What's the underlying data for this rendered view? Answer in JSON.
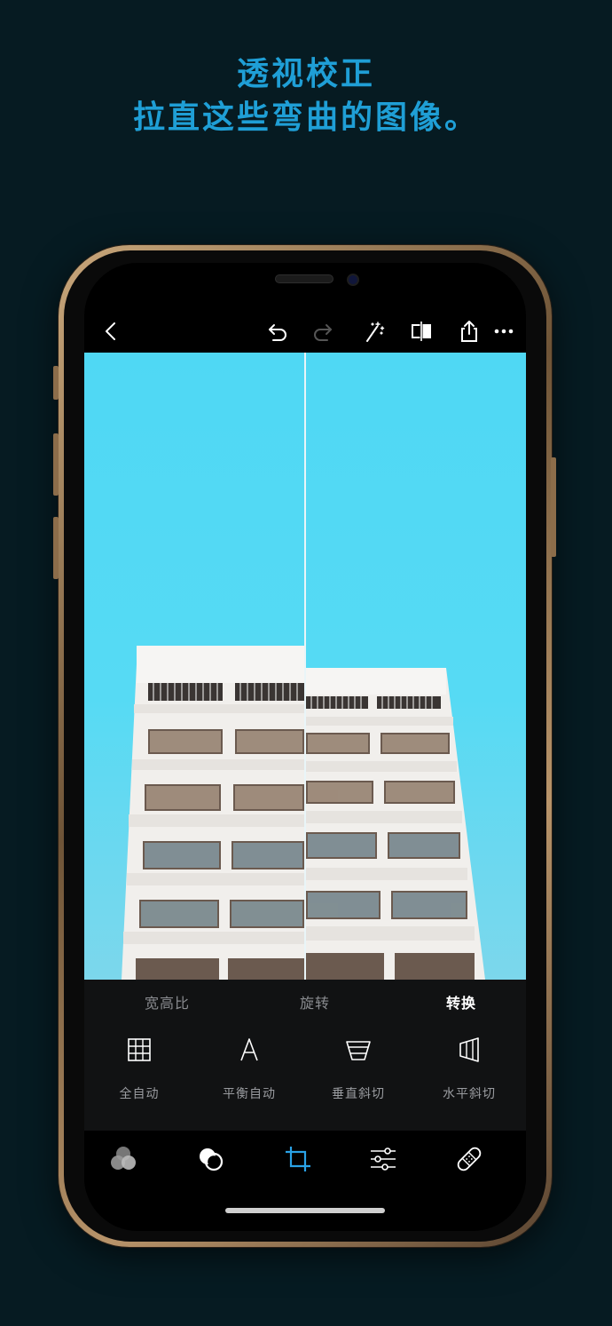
{
  "headline": {
    "line1": "透视校正",
    "line2": "拉直这些弯曲的图像。"
  },
  "toolbar": {
    "icons": [
      "back-icon",
      "undo-icon",
      "redo-icon",
      "magic-wand-icon",
      "compare-icon",
      "share-icon",
      "more-icon"
    ]
  },
  "crop_panel": {
    "tabs": [
      {
        "label": "宽高比",
        "active": false
      },
      {
        "label": "旋转",
        "active": false
      },
      {
        "label": "转换",
        "active": true
      }
    ],
    "tools": [
      {
        "label": "全自动",
        "icon": "grid-icon"
      },
      {
        "label": "平衡自动",
        "icon": "letter-a-icon"
      },
      {
        "label": "垂直斜切",
        "icon": "vertical-skew-icon"
      },
      {
        "label": "水平斜切",
        "icon": "horizontal-skew-icon"
      }
    ]
  },
  "bottom_nav": {
    "items": [
      "filters-icon",
      "layers-icon",
      "crop-icon",
      "adjust-sliders-icon",
      "healing-bandage-icon"
    ],
    "active": "crop-icon"
  },
  "colors": {
    "background": "#061b22",
    "headline": "#1f9fd6",
    "accent": "#2aa2e6",
    "sky": "#4fd8f4"
  }
}
